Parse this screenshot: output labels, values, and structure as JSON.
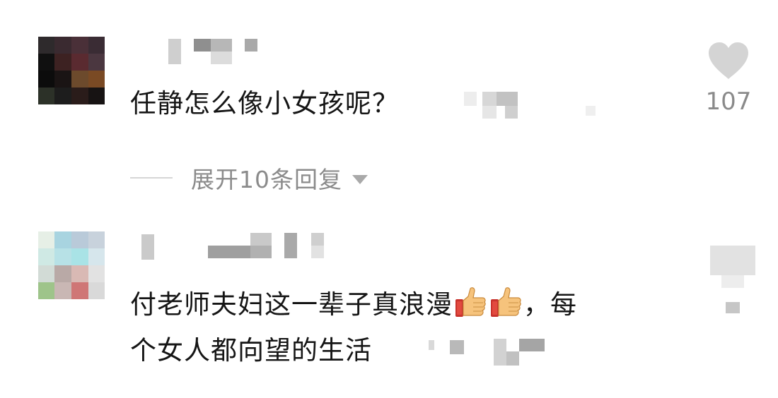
{
  "comments": [
    {
      "text": "任静怎么像小女孩呢？",
      "likes": "107",
      "replies_label": "展开10条回复"
    },
    {
      "text_main": "付老师夫妇这一辈子真浪漫",
      "text_tail": "，每",
      "text_line2": "个女人都向望的生活"
    }
  ],
  "icons": {
    "like": "heart-icon",
    "reply_expand": "chevron-down-icon",
    "emoji": "thumbs-up-icon"
  },
  "colors": {
    "heart": "#d4d4d4",
    "muted_text": "#8b8b8b"
  }
}
